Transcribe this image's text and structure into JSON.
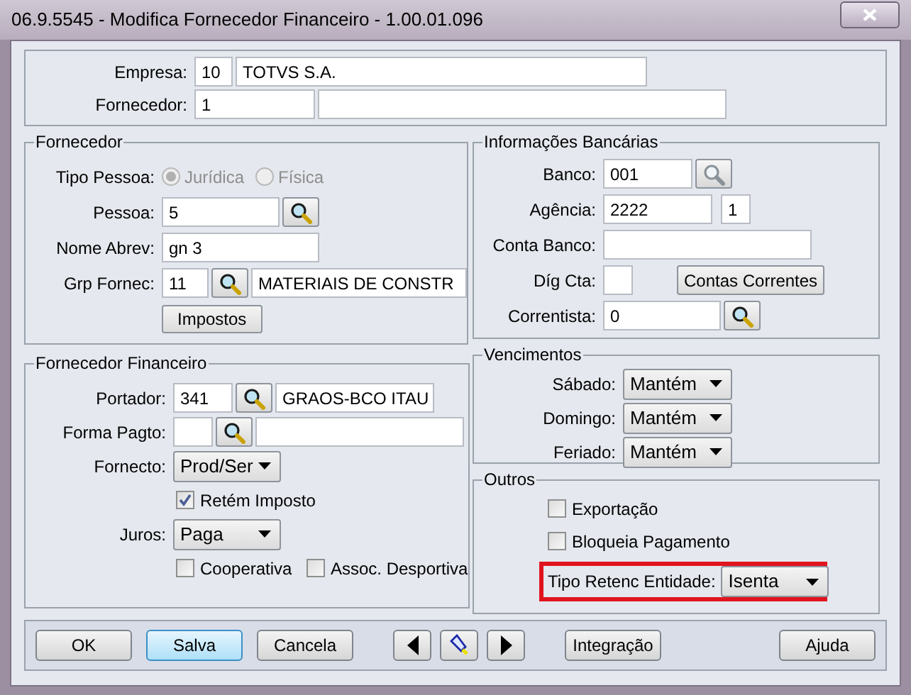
{
  "window": {
    "title": "06.9.5545 - Modifica Fornecedor Financeiro - 1.00.01.096"
  },
  "header": {
    "empresa": {
      "label": "Empresa:",
      "code": "10",
      "name": "TOTVS S.A."
    },
    "fornecedor": {
      "label": "Fornecedor:",
      "code": "1"
    }
  },
  "fornecedor": {
    "title": "Fornecedor",
    "tipo_pessoa": {
      "label": "Tipo Pessoa:",
      "options": [
        {
          "label": "Jurídica",
          "selected": true,
          "disabled": true
        },
        {
          "label": "Física",
          "selected": false,
          "disabled": true
        }
      ]
    },
    "pessoa": {
      "label": "Pessoa:",
      "value": "5"
    },
    "nome_abrev": {
      "label": "Nome Abrev:",
      "value": "gn 3"
    },
    "grp_fornec": {
      "label": "Grp Fornec:",
      "code": "11",
      "name": "MATERIAIS DE CONSTR"
    },
    "impostos_button": "Impostos"
  },
  "fornecedor_financeiro": {
    "title": "Fornecedor Financeiro",
    "portador": {
      "label": "Portador:",
      "code": "341",
      "name": "GRAOS-BCO ITAU"
    },
    "forma_pagto": {
      "label": "Forma Pagto:"
    },
    "fornecto": {
      "label": "Fornecto:",
      "value": "Prod/Ser"
    },
    "retem_imposto": {
      "label": "Retém Imposto",
      "checked": true
    },
    "juros": {
      "label": "Juros:",
      "value": "Paga"
    },
    "cooperativa": {
      "label": "Cooperativa",
      "checked": false
    },
    "assoc_desportiva": {
      "label": "Assoc. Desportiva",
      "checked": false
    }
  },
  "informacoes_bancarias": {
    "title": "Informações Bancárias",
    "banco": {
      "label": "Banco:",
      "value": "001",
      "lookup_disabled": true
    },
    "agencia": {
      "label": "Agência:",
      "value": "2222",
      "digit": "1"
    },
    "conta_banco": {
      "label": "Conta Banco:"
    },
    "dig_cta": {
      "label": "Díg Cta:"
    },
    "contas_correntes_button": "Contas Correntes",
    "correntista": {
      "label": "Correntista:",
      "value": "0"
    }
  },
  "vencimentos": {
    "title": "Vencimentos",
    "rows": [
      {
        "label": "Sábado:",
        "value": "Mantém"
      },
      {
        "label": "Domingo:",
        "value": "Mantém"
      },
      {
        "label": "Feriado:",
        "value": "Mantém"
      }
    ]
  },
  "outros": {
    "title": "Outros",
    "checkboxes": [
      {
        "label": "Exportação",
        "checked": false
      },
      {
        "label": "Bloqueia Pagamento",
        "checked": false
      }
    ],
    "tipo_retenc": {
      "label": "Tipo Retenc Entidade:",
      "value": "Isenta",
      "highlighted": true
    }
  },
  "buttons": [
    {
      "kind": "text",
      "label": "OK",
      "focused": false
    },
    {
      "kind": "text",
      "label": "Salva",
      "focused": true
    },
    {
      "kind": "text",
      "label": "Cancela",
      "focused": false
    },
    {
      "kind": "prev"
    },
    {
      "kind": "tool"
    },
    {
      "kind": "next"
    },
    {
      "kind": "text",
      "label": "Integração",
      "focused": false
    },
    {
      "kind": "text",
      "label": "Ajuda",
      "focused": false
    }
  ]
}
